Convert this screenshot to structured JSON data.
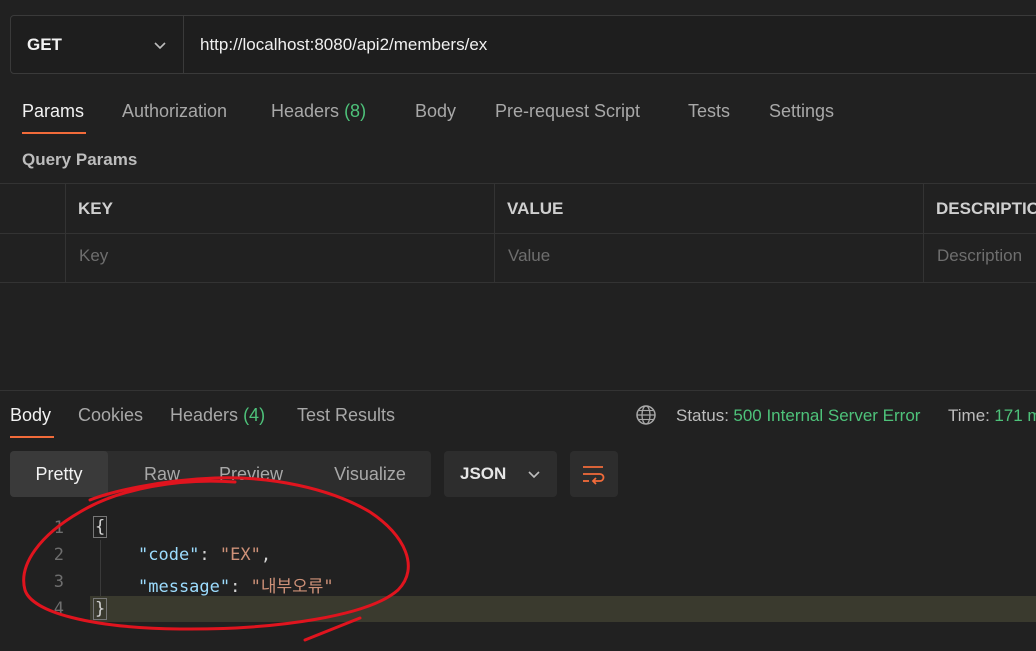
{
  "request": {
    "method": "GET",
    "url": "http://localhost:8080/api2/members/ex"
  },
  "request_tabs": [
    {
      "label": "Params",
      "active": true
    },
    {
      "label": "Authorization"
    },
    {
      "label": "Headers",
      "count": "(8)"
    },
    {
      "label": "Body"
    },
    {
      "label": "Pre-request Script"
    },
    {
      "label": "Tests"
    },
    {
      "label": "Settings"
    }
  ],
  "query_params": {
    "title": "Query Params",
    "columns": [
      "KEY",
      "VALUE",
      "DESCRIPTIO"
    ],
    "placeholders": [
      "Key",
      "Value",
      "Description"
    ]
  },
  "response_tabs": [
    {
      "label": "Body",
      "active": true
    },
    {
      "label": "Cookies"
    },
    {
      "label": "Headers",
      "count": "(4)"
    },
    {
      "label": "Test Results"
    }
  ],
  "status": {
    "label": "Status:",
    "value": "500 Internal Server Error",
    "time_label": "Time:",
    "time_value": "171 m"
  },
  "view_modes": [
    "Pretty",
    "Raw",
    "Preview",
    "Visualize"
  ],
  "active_view": "Pretty",
  "format": "JSON",
  "code_lines": [
    {
      "n": "1",
      "open": "{"
    },
    {
      "n": "2",
      "key": "\"code\"",
      "value": "\"EX\"",
      "trail": ","
    },
    {
      "n": "3",
      "key": "\"message\"",
      "value": "\"내부오류\""
    },
    {
      "n": "4",
      "close": "}"
    }
  ],
  "colors": {
    "accent": "#f26b3a",
    "success": "#4ec27a",
    "annotation": "#e0141e"
  }
}
